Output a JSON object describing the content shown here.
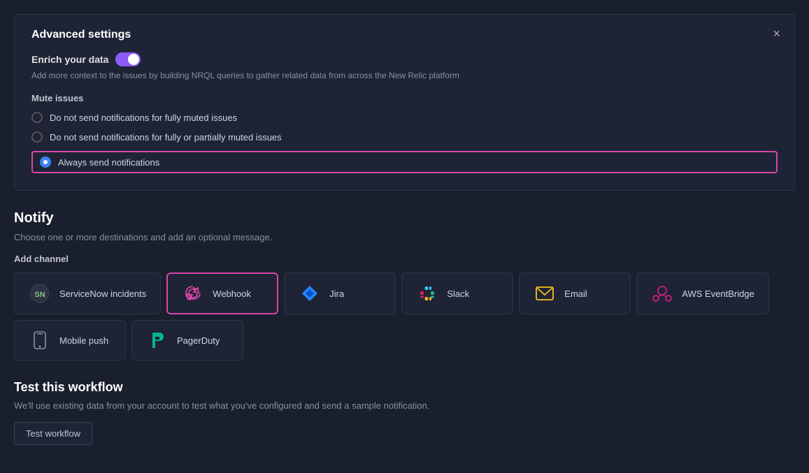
{
  "advanced_settings": {
    "title": "Advanced settings",
    "close_label": "×",
    "enrich": {
      "label": "Enrich your data",
      "toggle_on": true,
      "description": "Add more context to the issues by building NRQL queries to gather related data from across the New Relic platform"
    },
    "mute_issues": {
      "label": "Mute issues",
      "options": [
        {
          "id": "opt1",
          "text": "Do not send notifications for fully muted issues",
          "selected": false
        },
        {
          "id": "opt2",
          "text": "Do not send notifications for fully or partially muted issues",
          "selected": false
        },
        {
          "id": "opt3",
          "text": "Always send notifications",
          "selected": true
        }
      ]
    }
  },
  "notify": {
    "title": "Notify",
    "description": "Choose one or more destinations and add an optional message.",
    "add_channel_label": "Add channel",
    "channels": [
      {
        "id": "servicenow",
        "name": "ServiceNow incidents",
        "icon": "servicenow",
        "selected": false
      },
      {
        "id": "webhook",
        "name": "Webhook",
        "icon": "webhook",
        "selected": true
      },
      {
        "id": "jira",
        "name": "Jira",
        "icon": "jira",
        "selected": false
      },
      {
        "id": "slack",
        "name": "Slack",
        "icon": "slack",
        "selected": false
      },
      {
        "id": "email",
        "name": "Email",
        "icon": "email",
        "selected": false
      },
      {
        "id": "aws",
        "name": "AWS EventBridge",
        "icon": "aws",
        "selected": false
      },
      {
        "id": "mobile",
        "name": "Mobile push",
        "icon": "mobile",
        "selected": false
      },
      {
        "id": "pagerduty",
        "name": "PagerDuty",
        "icon": "pagerduty",
        "selected": false
      }
    ]
  },
  "test_workflow": {
    "title": "Test this workflow",
    "description": "We'll use existing data from your account to test what you've configured and send a sample notification.",
    "button_label": "Test workflow"
  }
}
